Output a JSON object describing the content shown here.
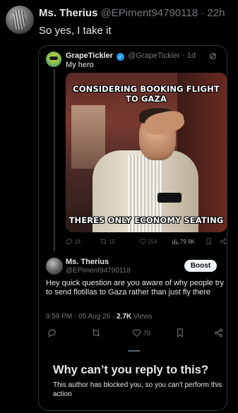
{
  "post": {
    "author_name": "Ms. Therius",
    "author_handle": "@EPiment94790118",
    "separator": "·",
    "time": "22h",
    "text": "So yes, I take it"
  },
  "quoted": {
    "author_name": "GrapeTickler",
    "verified_glyph": "✓",
    "author_handle": "@GrapeTickler",
    "separator": "·",
    "time": "1d",
    "text": "My hero",
    "meme_top_caption": "CONSIDERING BOOKING FLIGHT TO GAZA",
    "meme_bottom_caption": "THERES ONLY ECONOMY SEATING",
    "actions": {
      "replies": "18",
      "reposts": "15",
      "likes": "254",
      "views": "79.9K"
    },
    "reply": {
      "author_name": "Ms. Therius",
      "author_handle": "@EPiment94790118",
      "boost_label": "Boost",
      "text": "Hey quick question are you aware of why people try to send flotillas to Gaza rather than just fly there",
      "time": "9:59 PM",
      "date": "05 Aug 26",
      "views_count": "2.7K",
      "views_label": "Views",
      "meta_sep": "·",
      "likes": "70"
    },
    "restriction": {
      "title": "Why can’t you reply to this?",
      "text": "This author has blocked you, so you can't perform this action"
    }
  },
  "icons": [
    "reply-icon",
    "repost-icon",
    "like-icon",
    "views-icon",
    "bookmark-icon",
    "share-icon",
    "grok-icon",
    "verified-icon"
  ],
  "colors": {
    "background": "#000000",
    "text": "#e7e9ea",
    "muted": "#71767b",
    "border": "#2f3336",
    "verified": "#1d9bf0"
  }
}
